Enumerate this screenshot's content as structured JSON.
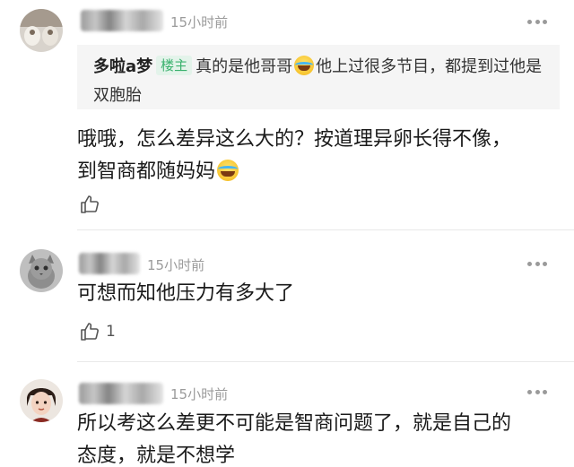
{
  "comments": [
    {
      "time": "15小时前",
      "quote": {
        "author": "多啦a梦",
        "tag": "楼主",
        "text_part1": "真的是他哥哥",
        "text_part2": "他上过很多节目，都提到过他是双胞胎"
      },
      "text_line1": "哦哦，怎么差异这么大的？按道理异卵长得不像，",
      "text_line2": "到智商都随妈妈",
      "likes": ""
    },
    {
      "time": "15小时前",
      "text_line1": "可想而知他压力有多大了",
      "likes": "1"
    },
    {
      "time": "15小时前",
      "text_line1": "所以考这么差更不可能是智商问题了，就是自己的",
      "text_line2": "态度，就是不想学"
    }
  ],
  "icons": [
    "avatar",
    "more-dots-icon",
    "thumbs-up-icon",
    "laughing-tears-emoji"
  ],
  "colors": {
    "tag_text": "#3bb26e",
    "tag_bg": "#e3f3ea",
    "time": "#9b9b9b"
  }
}
